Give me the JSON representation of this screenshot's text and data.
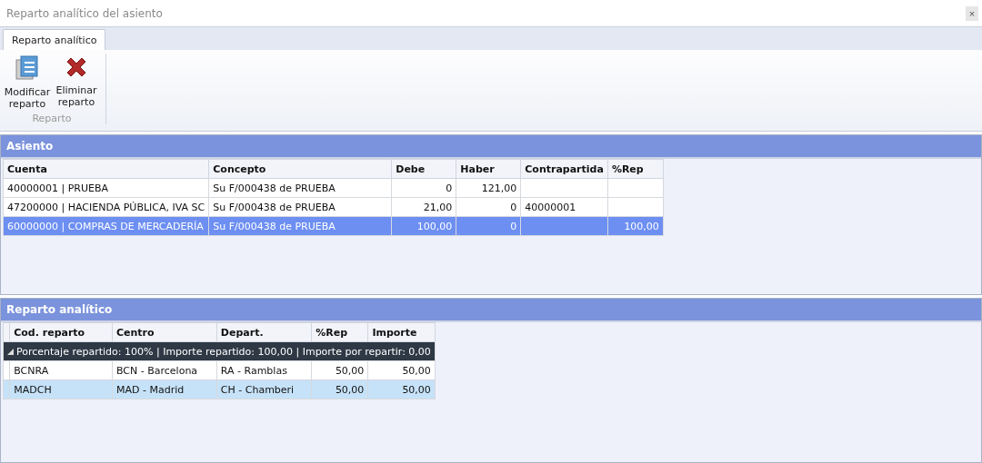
{
  "window": {
    "title": "Reparto analítico del asiento",
    "close_label": "×"
  },
  "tabs": [
    {
      "label": "Reparto analítico",
      "selected": true
    }
  ],
  "ribbon": {
    "groups": [
      {
        "label": "Reparto",
        "buttons": [
          {
            "label": "Modificar reparto",
            "kind": "edit"
          },
          {
            "label": "Eliminar reparto",
            "kind": "delete"
          }
        ]
      }
    ]
  },
  "asiento": {
    "title": "Asiento",
    "columns": [
      {
        "label": "Cuenta",
        "kind": "text"
      },
      {
        "label": "Concepto",
        "kind": "text"
      },
      {
        "label": "Debe",
        "kind": "number"
      },
      {
        "label": "Haber",
        "kind": "number"
      },
      {
        "label": "Contrapartida",
        "kind": "text"
      },
      {
        "label": "%Rep",
        "kind": "number"
      }
    ],
    "rows": [
      {
        "selected": false,
        "cells": [
          "40000001 | PRUEBA",
          "Su F/000438 de PRUEBA",
          "0",
          "121,00",
          "",
          ""
        ]
      },
      {
        "selected": false,
        "cells": [
          "47200000 | HACIENDA PÚBLICA, IVA SC",
          "Su F/000438 de PRUEBA",
          "21,00",
          "0",
          "40000001",
          ""
        ]
      },
      {
        "selected": true,
        "cells": [
          "60000000 | COMPRAS DE MERCADERÍA",
          "Su F/000438 de PRUEBA",
          "100,00",
          "0",
          "",
          "100,00"
        ]
      }
    ]
  },
  "reparto": {
    "title": "Reparto analítico",
    "columns": [
      {
        "label": "Cod. reparto",
        "kind": "text"
      },
      {
        "label": "Centro",
        "kind": "text"
      },
      {
        "label": "Depart.",
        "kind": "text"
      },
      {
        "label": "%Rep",
        "kind": "number"
      },
      {
        "label": "Importe",
        "kind": "number"
      }
    ],
    "group": {
      "label": "Porcentaje repartido: 100% | Importe repartido: 100,00 | Importe por repartir: 0,00",
      "expanded": true
    },
    "rows": [
      {
        "selected": false,
        "cells": [
          "BCNRA",
          "BCN - Barcelona",
          "RA - Ramblas",
          "50,00",
          "50,00"
        ]
      },
      {
        "selected": true,
        "cells": [
          "MADCH",
          "MAD - Madrid",
          "CH - Chamberi",
          "50,00",
          "50,00"
        ]
      }
    ]
  }
}
